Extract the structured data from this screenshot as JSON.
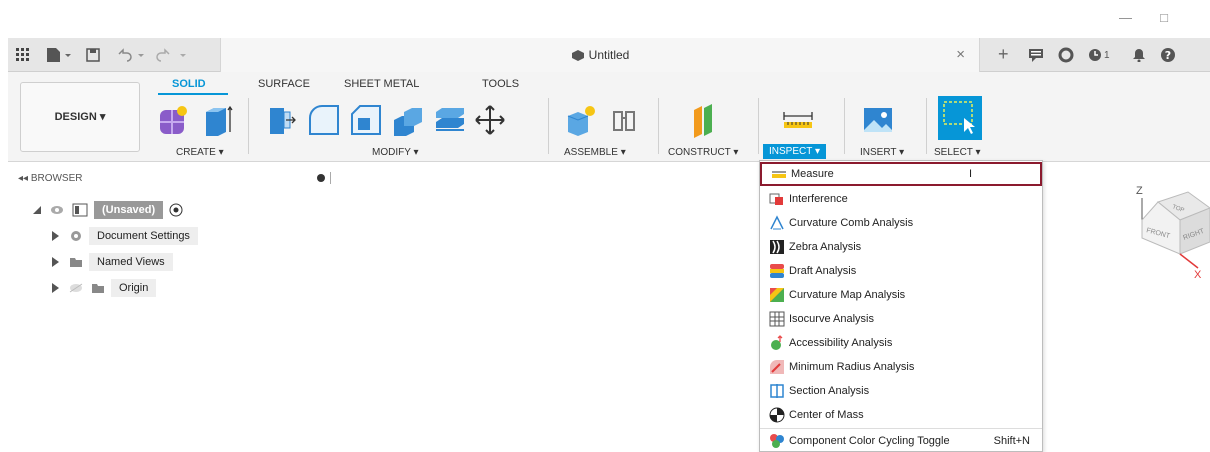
{
  "window": {
    "minimize_glyph": "—",
    "maximize_glyph": "□",
    "document_title": "Untitled",
    "close_tab_glyph": "×",
    "add_tab_glyph": "+",
    "notifications_count": "1"
  },
  "ribbon": {
    "workspace_button": "DESIGN ▾",
    "tabs": [
      "SOLID",
      "SURFACE",
      "SHEET METAL",
      "TOOLS"
    ],
    "groups": {
      "create": "CREATE ▾",
      "modify": "MODIFY ▾",
      "assemble": "ASSEMBLE ▾",
      "construct": "CONSTRUCT ▾",
      "inspect": "INSPECT ▾",
      "insert": "INSERT ▾",
      "select": "SELECT ▾"
    }
  },
  "browser": {
    "header": "◂◂ BROWSER",
    "items": [
      {
        "label": "(Unsaved)"
      },
      {
        "label": "Document Settings"
      },
      {
        "label": "Named Views"
      },
      {
        "label": "Origin"
      }
    ]
  },
  "inspect_menu": {
    "items": [
      {
        "label": "Measure",
        "shortcut": "I"
      },
      {
        "label": "Interference",
        "shortcut": ""
      },
      {
        "label": "Curvature Comb Analysis",
        "shortcut": ""
      },
      {
        "label": "Zebra Analysis",
        "shortcut": ""
      },
      {
        "label": "Draft Analysis",
        "shortcut": ""
      },
      {
        "label": "Curvature Map Analysis",
        "shortcut": ""
      },
      {
        "label": "Isocurve Analysis",
        "shortcut": ""
      },
      {
        "label": "Accessibility Analysis",
        "shortcut": ""
      },
      {
        "label": "Minimum Radius Analysis",
        "shortcut": ""
      },
      {
        "label": "Section Analysis",
        "shortcut": ""
      },
      {
        "label": "Center of Mass",
        "shortcut": ""
      },
      {
        "label": "Component Color Cycling Toggle",
        "shortcut": "Shift+N"
      }
    ]
  },
  "viewcube": {
    "top": "TOP",
    "front": "FRONT",
    "right": "RIGHT",
    "axis_z": "Z",
    "axis_x": "X"
  },
  "colors": {
    "accent": "#0696d7",
    "highlight_border": "#8b1a2e"
  }
}
